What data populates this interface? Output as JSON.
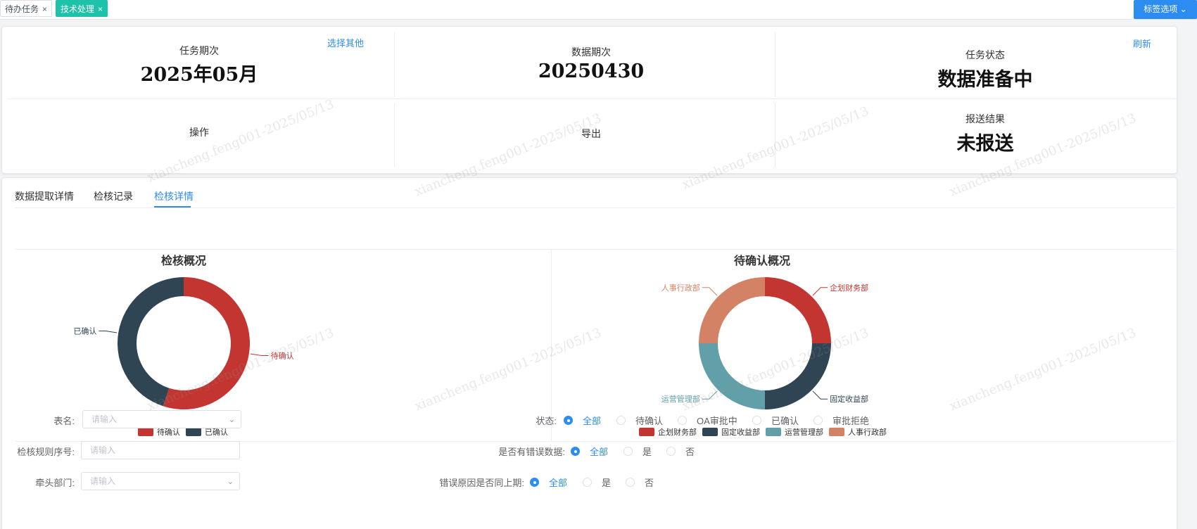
{
  "tabs": {
    "items": [
      {
        "label": "待办任务",
        "close": "×"
      },
      {
        "label": "技术处理",
        "close": "×"
      }
    ],
    "options_label": "标签选项"
  },
  "info": {
    "task_period_label": "任务期次",
    "task_period_value": "2025年05月",
    "select_other": "选择其他",
    "data_period_label": "数据期次",
    "data_period_value": "20250430",
    "task_status_label": "任务状态",
    "task_status_value": "数据准备中",
    "refresh": "刷新",
    "operation_label": "操作",
    "export_label": "导出",
    "report_result_label": "报送结果",
    "report_result_value": "未报送"
  },
  "detail_tabs": [
    {
      "label": "数据提取详情"
    },
    {
      "label": "检核记录"
    },
    {
      "label": "检核详情"
    }
  ],
  "chart_data": [
    {
      "type": "pie",
      "title": "检核概况",
      "categories": [
        "待确认",
        "已确认"
      ],
      "values": [
        55,
        45
      ],
      "colors": [
        "#c23531",
        "#2f4554"
      ],
      "legend_position": "bottom"
    },
    {
      "type": "pie",
      "title": "待确认概况",
      "categories": [
        "企划财务部",
        "固定收益部",
        "运营管理部",
        "人事行政部"
      ],
      "values": [
        25,
        25,
        25,
        25
      ],
      "colors": [
        "#c23531",
        "#2f4554",
        "#61a0a8",
        "#d48265"
      ],
      "legend_position": "bottom"
    }
  ],
  "form": {
    "table_name_label": "表名:",
    "table_name_placeholder": "请输入",
    "status_label": "状态:",
    "status_options": [
      "全部",
      "待确认",
      "OA审批中",
      "已确认",
      "审批拒绝"
    ],
    "status_selected": "全部",
    "rule_no_label": "检核规则序号:",
    "rule_no_placeholder": "请输入",
    "has_error_label": "是否有错误数据:",
    "has_error_options": [
      "全部",
      "是",
      "否"
    ],
    "lead_dept_label": "牵头部门:",
    "lead_dept_placeholder": "请输入",
    "same_reason_label": "错误原因是否同上期:",
    "same_reason_options": [
      "全部",
      "是",
      "否"
    ]
  },
  "watermark": "xiancheng.feng001-2025/05/13"
}
